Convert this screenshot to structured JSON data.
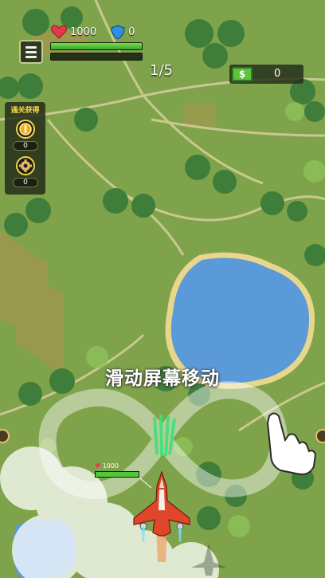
{
  "hud": {
    "hp": "1000",
    "shield": "0",
    "hp_fill_fraction": 1.0,
    "exp_fill_fraction": 0.0,
    "wave": "1/5"
  },
  "cash": {
    "icon_label": "$",
    "value": "0"
  },
  "rewards": {
    "title": "通关获得",
    "items": [
      {
        "icon": "gold-coin-icon",
        "count": "0"
      },
      {
        "icon": "gear-part-icon",
        "count": "0"
      }
    ]
  },
  "hint": "滑动屏幕移动",
  "player": {
    "hp": "1000"
  },
  "colors": {
    "grass": "#7fa34a",
    "lake": "#5a9ad8",
    "path": "#c9c98f",
    "hp_green": "#4fc83a",
    "plane_red": "#e0462a"
  }
}
